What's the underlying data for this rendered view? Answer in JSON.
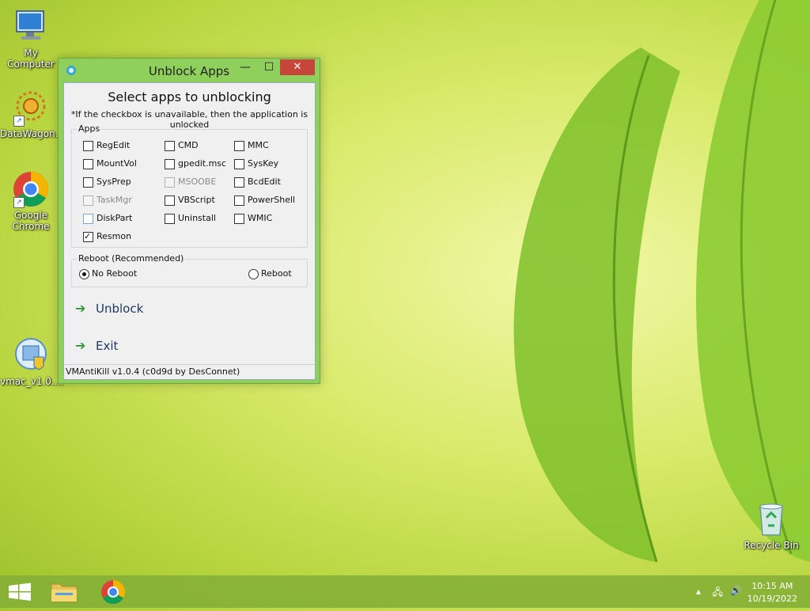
{
  "desktop": {
    "icons": [
      {
        "label": "My Computer",
        "icon": "monitor-icon"
      },
      {
        "label": "DataWagon...",
        "icon": "datawagon-icon"
      },
      {
        "label": "Google Chrome",
        "icon": "chrome-icon"
      },
      {
        "label": "vmac_v1.0....",
        "icon": "installer-icon"
      },
      {
        "label": "Recycle Bin",
        "icon": "recycle-bin-icon"
      }
    ]
  },
  "window": {
    "title": "Unblock Apps",
    "minimize_glyph": "—",
    "maximize_glyph": "☐",
    "close_glyph": "✕",
    "heading": "Select apps to unblocking",
    "note": "*If the checkbox is unavailable, then the application is unlocked",
    "apps_group_label": "Apps",
    "apps": [
      {
        "label": "RegEdit",
        "checked": false,
        "disabled": false
      },
      {
        "label": "CMD",
        "checked": false,
        "disabled": false
      },
      {
        "label": "MMC",
        "checked": false,
        "disabled": false
      },
      {
        "label": "MountVol",
        "checked": false,
        "disabled": false
      },
      {
        "label": "gpedit.msc",
        "checked": false,
        "disabled": false
      },
      {
        "label": "SysKey",
        "checked": false,
        "disabled": false
      },
      {
        "label": "SysPrep",
        "checked": false,
        "disabled": false
      },
      {
        "label": "MSOOBE",
        "checked": false,
        "disabled": true
      },
      {
        "label": "BcdEdit",
        "checked": false,
        "disabled": false
      },
      {
        "label": "TaskMgr",
        "checked": false,
        "disabled": true
      },
      {
        "label": "VBScript",
        "checked": false,
        "disabled": false
      },
      {
        "label": "PowerShell",
        "checked": false,
        "disabled": false
      },
      {
        "label": "DiskPart",
        "checked": false,
        "disabled": false
      },
      {
        "label": "Uninstall",
        "checked": false,
        "disabled": false
      },
      {
        "label": "WMIC",
        "checked": false,
        "disabled": false
      },
      {
        "label": "Resmon",
        "checked": true,
        "disabled": false
      }
    ],
    "reboot_group_label": "Reboot (Recommended)",
    "reboot_options": [
      {
        "label": "No Reboot",
        "selected": true
      },
      {
        "label": "Reboot",
        "selected": false
      }
    ],
    "unblock_label": "Unblock",
    "exit_label": "Exit",
    "status": "VMAntiKill v1.0.4 (c0d9d by DesConnet)"
  },
  "taskbar": {
    "time": "10:15 AM",
    "date": "10/19/2022",
    "tray_up_glyph": "▲",
    "network_glyph": "🖧",
    "volume_glyph": "🔊"
  }
}
